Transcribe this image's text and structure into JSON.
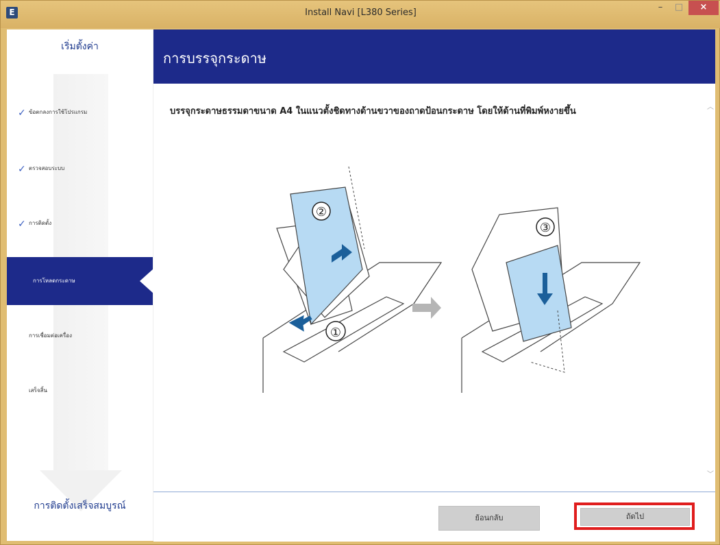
{
  "window": {
    "title": "Install Navi [L380 Series]",
    "app_icon": "E",
    "controls": {
      "minimize": "–",
      "maximize": "□",
      "close": "×"
    }
  },
  "sidebar": {
    "top_label": "เริ่มตั้งค่า",
    "items": [
      {
        "label": "ข้อตกลงการใช้โปรแกรม",
        "done": true
      },
      {
        "label": "ตรวจสอบระบบ",
        "done": true
      },
      {
        "label": "การติดตั้ง",
        "done": true
      },
      {
        "label": "การโหลดกระดาษ",
        "current": true
      },
      {
        "label": "การเชื่อมต่อเครื่อง"
      },
      {
        "label": "เสร็จสิ้น"
      }
    ],
    "bottom_label": "การติดตั้งเสร็จสมบูรณ์"
  },
  "header": {
    "title": "การบรรจุกระดาษ"
  },
  "content": {
    "instruction": "บรรจุกระดาษธรรมดาขนาด A4 ในแนวตั้งชิดทางด้านขวาของถาดป้อนกระดาษ โดยให้ด้านที่พิมพ์หงายขึ้น",
    "steps": [
      "①",
      "②",
      "③"
    ]
  },
  "footer": {
    "back_label": "ย้อนกลับ",
    "next_label": "ถัดไป"
  },
  "colors": {
    "header": "#1d2a8a",
    "titlebar": "#e0bd72",
    "highlight": "#e01d1d",
    "paper": "#b7daf3",
    "arrow": "#1b5f9a"
  },
  "icons": {
    "check": "check-icon",
    "scroll_up": "chevron-up-icon",
    "scroll_down": "chevron-down-icon",
    "transition": "arrow-right-icon"
  }
}
